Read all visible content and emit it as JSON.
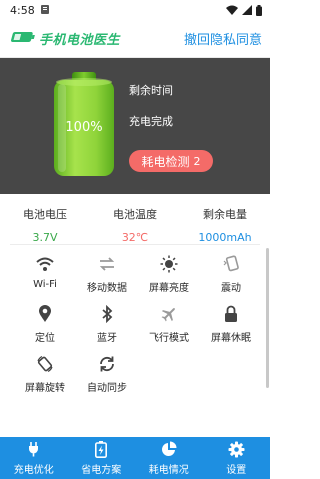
{
  "status_bar": {
    "time": "4:58",
    "icons": [
      "notification-icon",
      "wifi-icon",
      "signal-icon",
      "battery-icon"
    ]
  },
  "header": {
    "app_name": "手机电池医生",
    "revoke_privacy": "撤回隐私同意"
  },
  "battery": {
    "level_text": "100%",
    "level": 1.0,
    "remaining_time_label": "剩余时间",
    "charge_status": "充电完成",
    "power_check_label": "耗电检测",
    "power_check_count": "2",
    "colors": {
      "fill": "#8fd43a",
      "fill_dark": "#5cae1e",
      "button": "#f46b68"
    }
  },
  "stats": [
    {
      "label": "电池电压",
      "value": "3.7V",
      "color": "#39a84a"
    },
    {
      "label": "电池温度",
      "value": "32℃",
      "color": "#f46b68"
    },
    {
      "label": "剩余电量",
      "value": "1000mAh",
      "color": "#1e8fe1"
    }
  ],
  "toggles": [
    {
      "label": "Wi-Fi",
      "icon": "wifi-icon"
    },
    {
      "label": "移动数据",
      "icon": "mobile-data-icon"
    },
    {
      "label": "屏幕亮度",
      "icon": "brightness-icon"
    },
    {
      "label": "震动",
      "icon": "vibrate-icon"
    },
    {
      "label": "定位",
      "icon": "location-icon"
    },
    {
      "label": "蓝牙",
      "icon": "bluetooth-icon"
    },
    {
      "label": "飞行模式",
      "icon": "airplane-icon"
    },
    {
      "label": "屏幕休眠",
      "icon": "screen-lock-icon"
    },
    {
      "label": "屏幕旋转",
      "icon": "screen-rotation-icon"
    },
    {
      "label": "自动同步",
      "icon": "sync-icon"
    }
  ],
  "nav": [
    {
      "label": "充电优化",
      "icon": "plug-icon"
    },
    {
      "label": "省电方案",
      "icon": "battery-saver-icon"
    },
    {
      "label": "耗电情况",
      "icon": "pie-chart-icon"
    },
    {
      "label": "设置",
      "icon": "gear-icon"
    }
  ],
  "colors": {
    "accent": "#1e8fe1",
    "brand": "#2bb872",
    "panel": "#474747"
  }
}
